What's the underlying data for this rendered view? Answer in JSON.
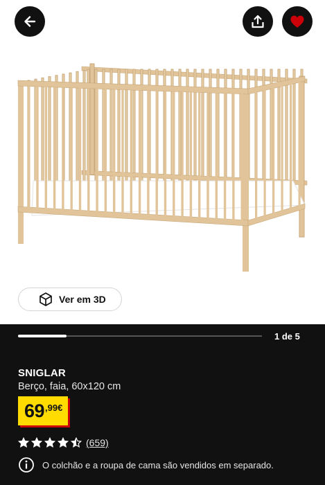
{
  "header": {
    "back_icon": "arrow-left-icon",
    "share_icon": "share-icon",
    "favorite_icon": "heart-icon",
    "favorite_color": "#cc0008"
  },
  "gallery": {
    "view_3d_label": "Ver em 3D",
    "counter": "1 de 5",
    "progress": 0.2
  },
  "product": {
    "name": "SNIGLAR",
    "description": "Berço, faia, 60x120 cm",
    "price_integer": "69",
    "price_decimal": ",99€",
    "rating": 4.5,
    "reviews": "(659)",
    "notice": "O colchão e a roupa de cama são vendidos em separado."
  },
  "colors": {
    "accent_yellow": "#ffdb00",
    "accent_red": "#cc0008",
    "panel_dark": "#111111"
  }
}
